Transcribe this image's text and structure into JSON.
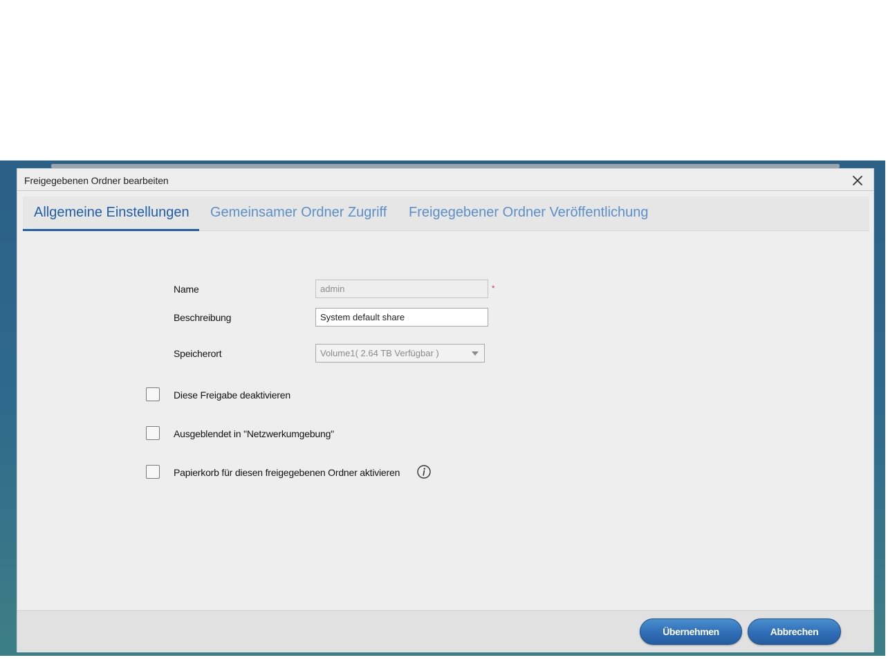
{
  "dialog": {
    "title": "Freigegebenen Ordner bearbeiten"
  },
  "tabs": [
    {
      "label": "Allgemeine Einstellungen",
      "active": true
    },
    {
      "label": "Gemeinsamer Ordner Zugriff",
      "active": false
    },
    {
      "label": "Freigegebener Ordner Veröffentlichung",
      "active": false
    }
  ],
  "form": {
    "name_label": "Name",
    "name_value": "admin",
    "required_marker": "*",
    "description_label": "Beschreibung",
    "description_value": "System default share",
    "location_label": "Speicherort",
    "location_value": "Volume1( 2.64 TB Verfügbar )"
  },
  "checkboxes": [
    {
      "label": "Diese Freigabe deaktivieren",
      "checked": false
    },
    {
      "label": "Ausgeblendet in \"Netzwerkumgebung\"",
      "checked": false
    },
    {
      "label": "Papierkorb für diesen freigegebenen Ordner aktivieren",
      "checked": false
    }
  ],
  "footer": {
    "apply_label": "Übernehmen",
    "cancel_label": "Abbrechen"
  },
  "colors": {
    "accent": "#1f5fa6",
    "button": "#2f6db5",
    "required": "#d9263c"
  }
}
